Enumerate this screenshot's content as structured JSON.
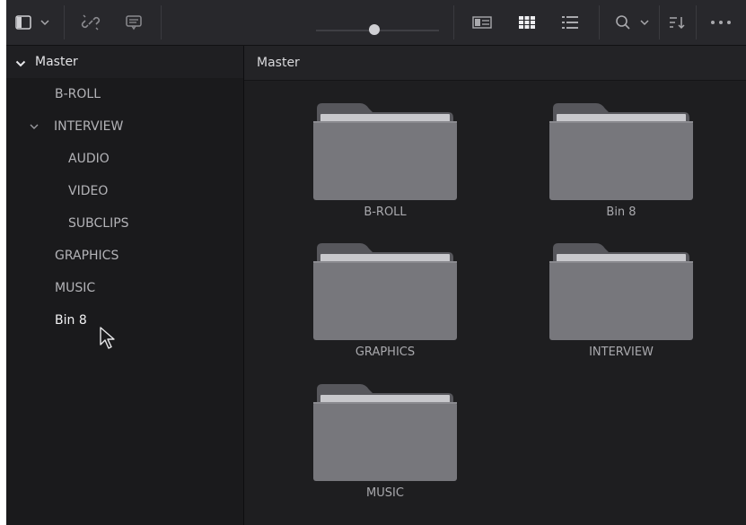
{
  "toolbar": {
    "icons": [
      "sidebar-toggle-icon",
      "chevron-down-icon",
      "unlink-icon",
      "comment-icon",
      "slider",
      "metadata-view-icon",
      "thumbnail-view-icon",
      "list-view-icon",
      "search-icon",
      "chevron-down-icon",
      "sort-icon",
      "more-icon"
    ],
    "zoom_slider_value": 0.45
  },
  "sidebar": {
    "header": "Master",
    "items": [
      {
        "label": "B-ROLL"
      },
      {
        "label": "INTERVIEW"
      },
      {
        "label": "AUDIO"
      },
      {
        "label": "VIDEO"
      },
      {
        "label": "SUBCLIPS"
      },
      {
        "label": "GRAPHICS"
      },
      {
        "label": "MUSIC"
      },
      {
        "label": "Bin 8"
      }
    ]
  },
  "main": {
    "header": "Master",
    "bins": [
      {
        "label": "B-ROLL"
      },
      {
        "label": "Bin 8"
      },
      {
        "label": "GRAPHICS"
      },
      {
        "label": "INTERVIEW"
      },
      {
        "label": "MUSIC"
      }
    ]
  }
}
